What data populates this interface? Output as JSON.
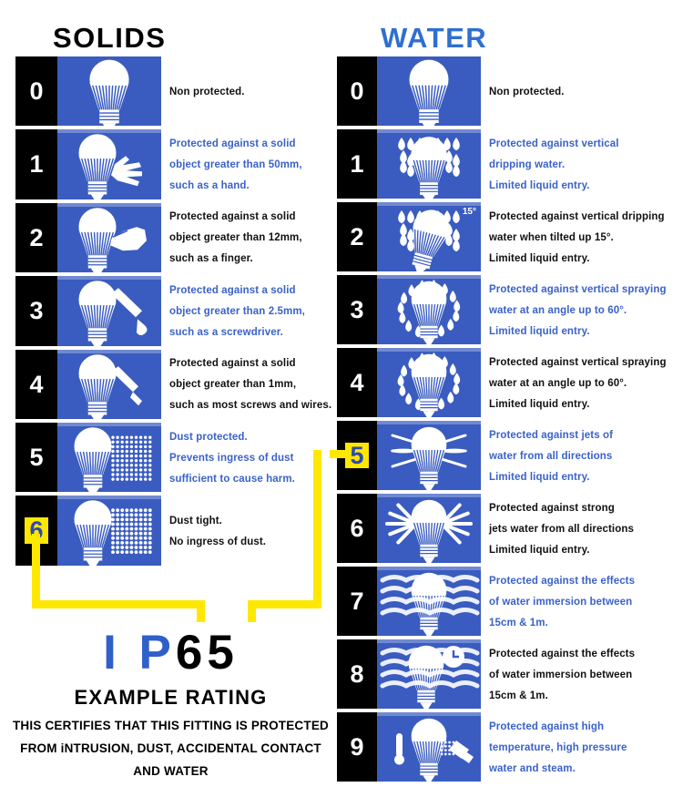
{
  "headings": {
    "solids": "SOLIDS",
    "water": "WATER"
  },
  "colors": {
    "panel_blue": "#3a5cc0",
    "text_blue": "#3a62c8",
    "text_dark": "#111111",
    "highlight_yellow": "#ffe800",
    "number_black": "#000000",
    "water_title_blue": "#2f6fd0"
  },
  "solids": [
    {
      "digit": "0",
      "icon": "bulb-plain-icon",
      "color": "dark",
      "text": "Non protected.",
      "highlight": false
    },
    {
      "digit": "1",
      "icon": "bulb-hand-icon",
      "color": "blue",
      "text": "Protected against a solid\nobject greater than 50mm,\nsuch as a hand.",
      "highlight": false
    },
    {
      "digit": "2",
      "icon": "bulb-finger-icon",
      "color": "dark",
      "text": "Protected against a solid\nobject greater than 12mm,\nsuch as a finger.",
      "highlight": false
    },
    {
      "digit": "3",
      "icon": "bulb-screwdriver-icon",
      "color": "blue",
      "text": "Protected against a solid\nobject greater than 2.5mm,\nsuch as a screwdriver.",
      "highlight": false
    },
    {
      "digit": "4",
      "icon": "bulb-wire-icon",
      "color": "dark",
      "text": "Protected against a solid\nobject greater than 1mm,\nsuch as most screws and wires.",
      "highlight": false
    },
    {
      "digit": "5",
      "icon": "bulb-dust-partial-icon",
      "color": "blue",
      "text": "Dust protected.\nPrevents ingress of dust\nsufficient to cause harm.",
      "highlight": false
    },
    {
      "digit": "6",
      "icon": "bulb-dust-tight-icon",
      "color": "dark",
      "text": "Dust tight.\nNo ingress of dust.",
      "highlight": true
    }
  ],
  "water": [
    {
      "digit": "0",
      "icon": "bulb-plain-icon",
      "color": "dark",
      "text": "Non protected.",
      "highlight": false,
      "badge": ""
    },
    {
      "digit": "1",
      "icon": "bulb-drip-icon",
      "color": "blue",
      "text": "Protected against vertical\ndripping water.\nLimited liquid entry.",
      "highlight": false,
      "badge": ""
    },
    {
      "digit": "2",
      "icon": "bulb-drip-tilt-icon",
      "color": "dark",
      "text": "Protected against vertical dripping\nwater when tilted up 15°.\nLimited liquid entry.",
      "highlight": false,
      "badge": "15°"
    },
    {
      "digit": "3",
      "icon": "bulb-spray-icon",
      "color": "blue",
      "text": "Protected against vertical spraying\nwater at an angle up to 60°.\nLimited liquid entry.",
      "highlight": false,
      "badge": ""
    },
    {
      "digit": "4",
      "icon": "bulb-spray-icon",
      "color": "dark",
      "text": "Protected against vertical spraying\nwater at an angle up to 60°.\nLimited liquid entry.",
      "highlight": false,
      "badge": ""
    },
    {
      "digit": "5",
      "icon": "bulb-jets-icon",
      "color": "blue",
      "text": "Protected against jets of\nwater from all directions\nLimited liquid entry.",
      "highlight": true,
      "badge": ""
    },
    {
      "digit": "6",
      "icon": "bulb-strong-jets-icon",
      "color": "dark",
      "text": "Protected against strong\njets water from all directions\nLimited liquid entry.",
      "highlight": false,
      "badge": ""
    },
    {
      "digit": "7",
      "icon": "bulb-immersion-icon",
      "color": "blue",
      "text": "Protected against the effects\nof water immersion between\n15cm & 1m.",
      "highlight": false,
      "badge": ""
    },
    {
      "digit": "8",
      "icon": "bulb-immersion-clock-icon",
      "color": "dark",
      "text": "Protected against the effects\nof water immersion between\n15cm & 1m.",
      "highlight": false,
      "badge": "clock-icon"
    },
    {
      "digit": "9",
      "icon": "bulb-steam-jet-icon",
      "color": "blue",
      "text": "Protected against high\ntemperature, high pressure\nwater and steam.",
      "highlight": false,
      "badge": "thermometer-icon"
    }
  ],
  "example": {
    "prefix": "I P",
    "digit_solids": "6",
    "digit_water": "5",
    "subtitle": "EXAMPLE RATING",
    "certification": "THIS CERTIFIES THAT THIS FITTING IS PROTECTED\nFROM iNTRUSION, DUST, ACCIDENTAL CONTACT\nAND WATER"
  }
}
